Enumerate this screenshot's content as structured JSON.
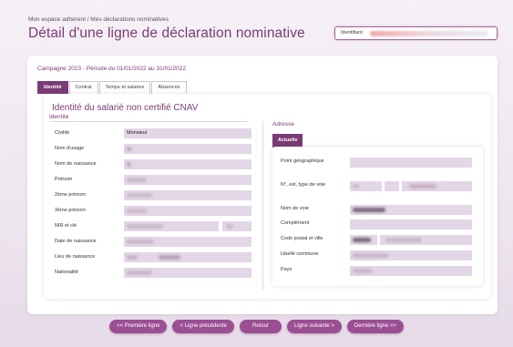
{
  "breadcrumb": "Mon espace adhérent / Mes déclarations nominatives",
  "page_title": "Détail d'une ligne de déclaration nominative",
  "identifier_label": "Identifiant",
  "campaign": "Campagne 2023 - Période du 01/01/2022 au 31/01/2022",
  "tabs": [
    {
      "label": "Identité",
      "active": true
    },
    {
      "label": "Contrat",
      "active": false
    },
    {
      "label": "Temps et salaires",
      "active": false
    },
    {
      "label": "Absences",
      "active": false
    }
  ],
  "section_title": "Identité du salarié non certifié CNAV",
  "identity": {
    "title": "Identité",
    "fields": [
      {
        "label": "Civilité",
        "value": "Monsieur"
      },
      {
        "label": "Nom d'usage",
        "value": ""
      },
      {
        "label": "Nom de naissance",
        "value": ""
      },
      {
        "label": "Prénom",
        "value": ""
      },
      {
        "label": "2ème prénom",
        "value": ""
      },
      {
        "label": "3ème prénom",
        "value": ""
      },
      {
        "label": "NIR et clé",
        "value": ""
      },
      {
        "label": "Date de naissance",
        "value": ""
      },
      {
        "label": "Lieu de naissance",
        "value": ""
      },
      {
        "label": "Nationalité",
        "value": ""
      }
    ]
  },
  "address": {
    "title": "Adresse",
    "subtab": "Actuelle",
    "fields": [
      {
        "label": "Point géographique"
      },
      {
        "label": "N°, ext, type de voie"
      },
      {
        "label": "Nom de voie"
      },
      {
        "label": "Complément"
      },
      {
        "label": "Code postal et ville"
      },
      {
        "label": "Libellé commune"
      },
      {
        "label": "Pays"
      }
    ]
  },
  "nav": {
    "first": "<< Première ligne",
    "prev": "< Ligne précédente",
    "back": "Retour",
    "next": "Ligne suivante >",
    "last": "Dernière ligne >>"
  },
  "colors": {
    "accent": "#7b3b74",
    "button": "#9c4e94",
    "field_bg": "#e3d6e6"
  }
}
